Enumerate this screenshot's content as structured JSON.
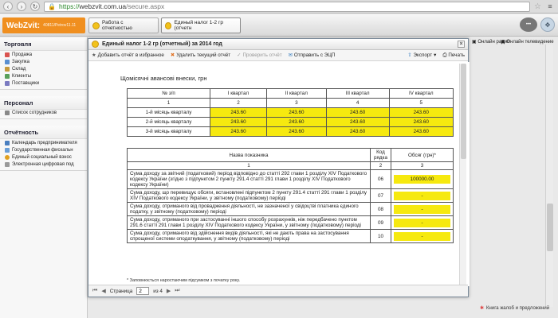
{
  "browser": {
    "https": "https://",
    "host": "webzvit.com.ua",
    "path": "/secure.aspx"
  },
  "app": {
    "brand": "WebZvit:",
    "user_id": "40811/Petrov11.11"
  },
  "tabs": [
    {
      "label": "Работа с отчетностью"
    },
    {
      "label": "Единый налог 1-2 гр (отчетн"
    }
  ],
  "right_links": {
    "radio": "Онлайн радио",
    "tv": "Онлайн телевидение",
    "book": "Книга жалоб и предложений"
  },
  "sidebar": {
    "sections": [
      {
        "title": "Торговля",
        "items": [
          "Продажа",
          "Закупка",
          "Склад",
          "Клиенты",
          "Поставщики"
        ]
      },
      {
        "title": "Персонал",
        "items": [
          "Список сотрудников"
        ]
      },
      {
        "title": "Отчётность",
        "items": [
          "Календарь предпринимателя",
          "Государственная фискальн",
          "Единый социальный взнос",
          "Электронная цифровая под"
        ]
      }
    ]
  },
  "dialog": {
    "title": "Единый налог 1-2 гр (отчетный) за 2014 год",
    "toolbar": {
      "add_fav": "Добавить отчёт в избранное",
      "delete": "Удалить текущий отчёт",
      "check": "Проверить отчёт",
      "send": "Отправить с ЭЦП",
      "export": "Экспорт",
      "print": "Печать"
    },
    "heading": "Щомісячні авансові внески, грн",
    "advances": {
      "headers": [
        "№ з/п",
        "I квартал",
        "II квартал",
        "III квартал",
        "IV квартал"
      ],
      "numbers": [
        "1",
        "2",
        "3",
        "4",
        "5"
      ],
      "rows": [
        {
          "label": "1-й місяць кварталу",
          "values": [
            "243.60",
            "243.60",
            "243.60",
            "243.60"
          ]
        },
        {
          "label": "2-й місяць кварталу",
          "values": [
            "243.60",
            "243.60",
            "243.60",
            "243.60"
          ]
        },
        {
          "label": "3-й місяць кварталу",
          "values": [
            "243.60",
            "243.60",
            "243.60",
            "243.60"
          ]
        }
      ]
    },
    "indicators": {
      "headers": [
        "Назва показника",
        "Код рядка",
        "Обсяг (грн)*"
      ],
      "numbers": [
        "1",
        "2",
        "3"
      ],
      "rows": [
        {
          "desc": "Сума доходу за звітний (податковий) період відповідно до статті 292 глави 1 розділу XIV Податкового кодексу України (згідно з підпунктом 2 пункту 291.4 статті 291 глави 1 розділу XIV Податкового кодексу України)",
          "code": "06",
          "value": "100000.00"
        },
        {
          "desc": "Сума доходу, що перевищує обсяги, встановлені підпунктом 2 пункту 291.4 статті 291 глави 1 розділу XIV Податкового кодексу України, у звітному (податковому) періоді",
          "code": "07",
          "value": "-"
        },
        {
          "desc": "Сума доходу, отриманого від провадження діяльності, не зазначеної у свідоцтві платника єдиного податку, у звітному (податковому) періоді",
          "code": "08",
          "value": "-"
        },
        {
          "desc": "Сума доходу, отриманого при застосуванні іншого способу розрахунків, ніж передбачено пунктом 291.6 статті 291 глави 1 розділу XIV Податкового кодексу України, у звітному (податковому) періоді",
          "code": "09",
          "value": "-"
        },
        {
          "desc": "Сума доходу, отриманого від здійснення видів діяльності, які не дають права на застосування спрощеної системи оподаткування, у звітному (податковому) періоді",
          "code": "10",
          "value": "-"
        }
      ]
    },
    "footnote": "* Заповнюється наростаючим підсумком з початку року.",
    "pager": {
      "label": "Страница",
      "current": "2",
      "of": "из 4"
    }
  }
}
